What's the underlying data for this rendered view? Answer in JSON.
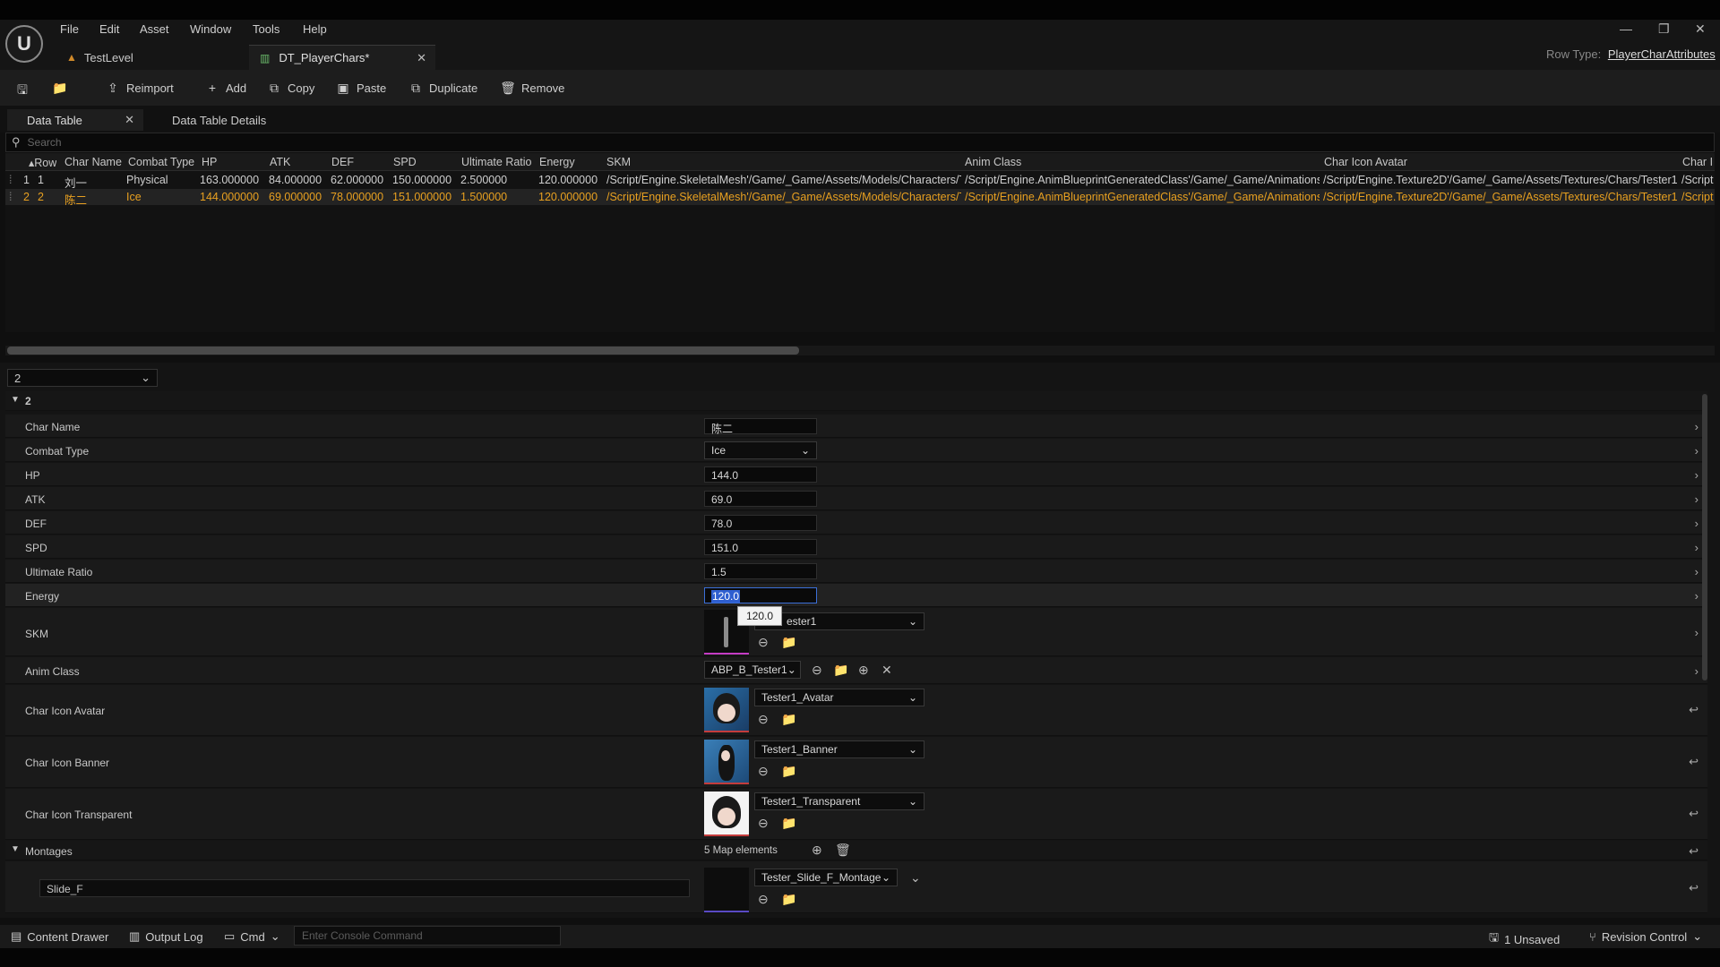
{
  "menu": {
    "items": [
      "File",
      "Edit",
      "Asset",
      "Window",
      "Tools",
      "Help"
    ]
  },
  "tabs": [
    {
      "label": "TestLevel"
    },
    {
      "label": "DT_PlayerChars*"
    }
  ],
  "row_type": {
    "label": "Row Type:",
    "value": "PlayerCharAttributes"
  },
  "toolbar": {
    "reimport": "Reimport",
    "add": "Add",
    "copy": "Copy",
    "paste": "Paste",
    "duplicate": "Duplicate",
    "remove": "Remove"
  },
  "subtabs": {
    "data_table": "Data Table",
    "details": "Data Table Details"
  },
  "search": {
    "placeholder": "Search"
  },
  "table": {
    "headers": [
      "Row",
      "Char Name",
      "Combat Type",
      "HP",
      "ATK",
      "DEF",
      "SPD",
      "Ultimate Ratio",
      "Energy",
      "SKM",
      "Anim Class",
      "Char Icon Avatar",
      "Char I"
    ],
    "rows": [
      {
        "idx": "1",
        "row": "1",
        "name": "刘一",
        "type": "Physical",
        "hp": "163.000000",
        "atk": "84.000000",
        "def": "62.000000",
        "spd": "150.000000",
        "ult": "2.500000",
        "energy": "120.000000",
        "skm": "/Script/Engine.SkeletalMesh'/Game/_Game/Assets/Models/Characters/T",
        "anim": "/Script/Engine.AnimBlueprintGeneratedClass'/Game/_Game/Animations.",
        "avatar": "/Script/Engine.Texture2D'/Game/_Game/Assets/Textures/Chars/Tester1.",
        "extra": "/Script"
      },
      {
        "idx": "2",
        "row": "2",
        "name": "陈二",
        "type": "Ice",
        "hp": "144.000000",
        "atk": "69.000000",
        "def": "78.000000",
        "spd": "151.000000",
        "ult": "1.500000",
        "energy": "120.000000",
        "skm": "/Script/Engine.SkeletalMesh'/Game/_Game/Assets/Models/Characters/T",
        "anim": "/Script/Engine.AnimBlueprintGeneratedClass'/Game/_Game/Animations.",
        "avatar": "/Script/Engine.Texture2D'/Game/_Game/Assets/Textures/Chars/Tester1.",
        "extra": "/Script"
      }
    ]
  },
  "details": {
    "row_selector": "2",
    "section": "2",
    "char_name": {
      "label": "Char Name",
      "value": "陈二"
    },
    "combat_type": {
      "label": "Combat Type",
      "value": "Ice"
    },
    "hp": {
      "label": "HP",
      "value": "144.0"
    },
    "atk": {
      "label": "ATK",
      "value": "69.0"
    },
    "def": {
      "label": "DEF",
      "value": "78.0"
    },
    "spd": {
      "label": "SPD",
      "value": "151.0"
    },
    "ult": {
      "label": "Ultimate Ratio",
      "value": "1.5"
    },
    "energy": {
      "label": "Energy",
      "value": "120.0",
      "tooltip": "120.0"
    },
    "skm": {
      "label": "SKM",
      "value": "ester1"
    },
    "anim": {
      "label": "Anim Class",
      "value": "ABP_B_Tester1"
    },
    "avatar": {
      "label": "Char Icon Avatar",
      "value": "Tester1_Avatar"
    },
    "banner": {
      "label": "Char Icon Banner",
      "value": "Tester1_Banner"
    },
    "transparent": {
      "label": "Char Icon Transparent",
      "value": "Tester1_Transparent"
    },
    "montages": {
      "label": "Montages",
      "count": "5 Map elements",
      "key": "Slide_F",
      "value": "Tester_Slide_F_Montage"
    }
  },
  "status": {
    "content_drawer": "Content Drawer",
    "output_log": "Output Log",
    "cmd": "Cmd",
    "console_placeholder": "Enter Console Command",
    "unsaved": "1 Unsaved",
    "revision": "Revision Control"
  },
  "colors": {
    "accent": "#f0b020",
    "selected_row_text": "#e8a020"
  }
}
